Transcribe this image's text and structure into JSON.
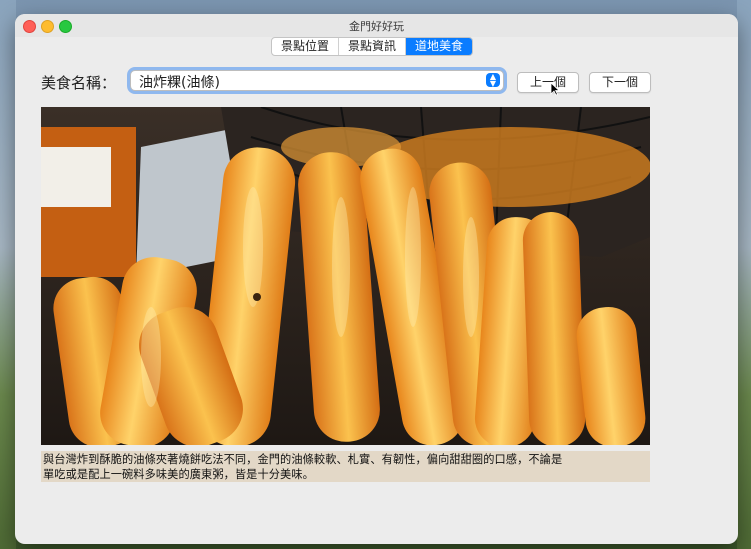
{
  "window": {
    "title": "金門好好玩"
  },
  "tabs": [
    {
      "label": "景點位置",
      "active": false
    },
    {
      "label": "景點資訊",
      "active": false
    },
    {
      "label": "道地美食",
      "active": true
    }
  ],
  "food": {
    "label": "美食名稱：",
    "selected": "油炸粿(油條)"
  },
  "buttons": {
    "prev": "上一個",
    "next": "下一個"
  },
  "photo": {
    "subject": "fried-dough-sticks"
  },
  "description": {
    "line1": "與台灣炸到酥脆的油條夾著燒餅吃法不同，金門的油條較軟、札實、有韌性，偏向甜甜圈的口感，不論是",
    "line2": "單吃或是配上一碗料多味美的廣東粥，皆是十分美味。"
  },
  "colors": {
    "accent": "#0a7cff",
    "caption_bg": "#e3d8c7"
  }
}
